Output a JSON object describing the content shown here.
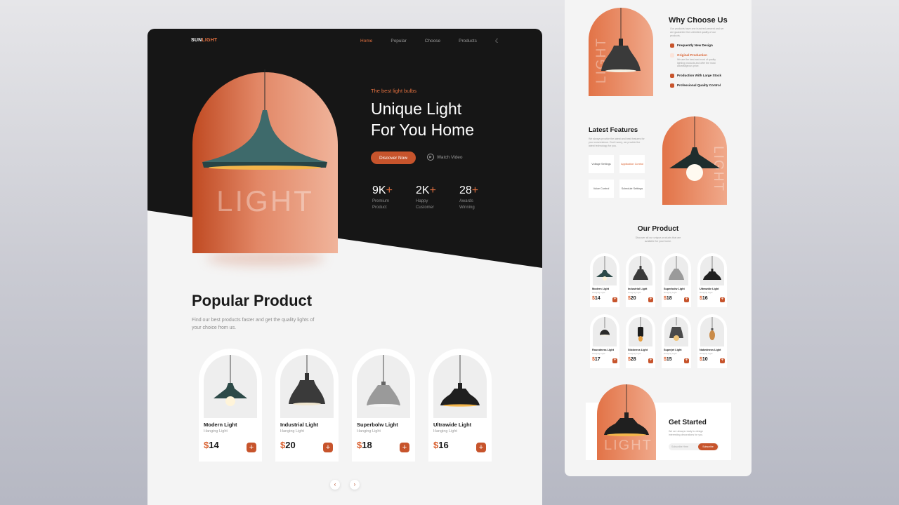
{
  "brand": {
    "logo_a": "SUN",
    "logo_b": "LIGHT",
    "accent": "#e2703f",
    "button": "#c7542c"
  },
  "nav": {
    "items": [
      "Home",
      "Popular",
      "Choose",
      "Products"
    ],
    "theme_icon": "moon-icon"
  },
  "hero": {
    "arch_text": "LIGHT",
    "tagline": "The best light bulbs",
    "headline_line1": "Unique Light",
    "headline_line2": "For You Home",
    "discover_label": "Discover Now",
    "watch_label": "Watch Video",
    "stats": [
      {
        "num": "9K",
        "plus": "+",
        "label1": "Premium",
        "label2": "Product"
      },
      {
        "num": "2K",
        "plus": "+",
        "label1": "Happy",
        "label2": "Customer"
      },
      {
        "num": "28",
        "plus": "+",
        "label1": "Awards",
        "label2": "Winning"
      }
    ]
  },
  "popular": {
    "title": "Popular Product",
    "desc": "Find our best products faster and get the quality lights of your choice from us.",
    "products": [
      {
        "name": "Modern Light",
        "sub": "Hanging Light",
        "currency": "$",
        "price": "14"
      },
      {
        "name": "Industrial Light",
        "sub": "Hanging Light",
        "currency": "$",
        "price": "20"
      },
      {
        "name": "Superbolw Light",
        "sub": "Hanging Light",
        "currency": "$",
        "price": "18"
      },
      {
        "name": "Ultrawide Light",
        "sub": "Hanging Light",
        "currency": "$",
        "price": "16"
      }
    ],
    "add_label": "+",
    "prev": "‹",
    "next": "›"
  },
  "side": {
    "why": {
      "arch_text": "LIGHT",
      "title": "Why Choose Us",
      "desc": "Our products have one hundred percent and we are guarantee the unlimited quality of our products.",
      "items": [
        {
          "label": "Frequently New Design",
          "sub": ""
        },
        {
          "label": "Original Production",
          "sub": "We are the best and most of quality lighting products and offer the most advantageous price."
        },
        {
          "label": "Production With Large Stock",
          "sub": ""
        },
        {
          "label": "Professional Quality Control",
          "sub": ""
        }
      ]
    },
    "features": {
      "title": "Latest Features",
      "desc": "We always provide the latest and best features for your convenience. Don't worry, we provide the latest technology for you.",
      "arch_text": "LIGHT",
      "items": [
        "Voltage Settings",
        "Application Control",
        "Voice Control",
        "Schedule Settings"
      ]
    },
    "our_product": {
      "title": "Our Product",
      "desc": "Discover all our unique products that are available for your home.",
      "items": [
        {
          "name": "Modern Light",
          "sub": "Hanging Light",
          "currency": "$",
          "price": "14"
        },
        {
          "name": "Industrial Light",
          "sub": "Hanging Light",
          "currency": "$",
          "price": "20"
        },
        {
          "name": "Superbolw Light",
          "sub": "Hanging Light",
          "currency": "$",
          "price": "18"
        },
        {
          "name": "Ultrawide Light",
          "sub": "Hanging Light",
          "currency": "$",
          "price": "16"
        },
        {
          "name": "Roundness Light",
          "sub": "Hanging Light",
          "currency": "$",
          "price": "17"
        },
        {
          "name": "Stickness Light",
          "sub": "Hanging Light",
          "currency": "$",
          "price": "28"
        },
        {
          "name": "Superjet Light",
          "sub": "Hanging Light",
          "currency": "$",
          "price": "15"
        },
        {
          "name": "Nakedness Light",
          "sub": "Hanging Light",
          "currency": "$",
          "price": "10"
        }
      ]
    },
    "get_started": {
      "arch_text": "LIGHT",
      "title": "Get Started",
      "desc": "We are always ready to design interesting decorations for you.",
      "input_placeholder": "Subscribe Here",
      "button": "Subscribe"
    }
  }
}
